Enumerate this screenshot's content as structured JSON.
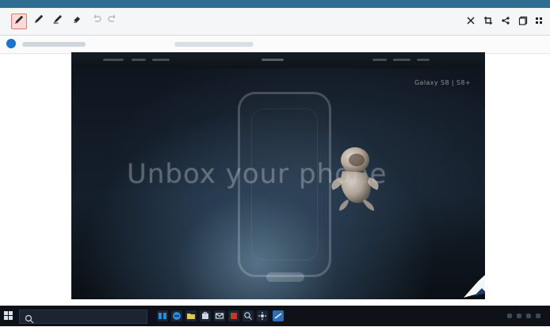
{
  "window": {
    "title": ""
  },
  "toolbar": {
    "left_tools": [
      {
        "name": "pen-tool-active-icon"
      },
      {
        "name": "pen-tool-icon"
      },
      {
        "name": "highlighter-icon"
      },
      {
        "name": "eraser-icon"
      },
      {
        "name": "undo-icon"
      },
      {
        "name": "redo-icon"
      }
    ],
    "right_tools": [
      {
        "name": "close-icon"
      },
      {
        "name": "crop-icon"
      },
      {
        "name": "share-icon"
      },
      {
        "name": "copy-icon"
      },
      {
        "name": "more-icon"
      }
    ]
  },
  "webpage": {
    "hero_text": "Unbox your phone",
    "top_right_label": "Galaxy S8 | S8+",
    "cta": ""
  },
  "taskbar": {
    "search_placeholder": "",
    "tray_time": ""
  },
  "colors": {
    "titlebar": "#2f6d91",
    "toolbar": "#f5f6f7",
    "taskbar": "#0e1218",
    "accent_active": "#e07a70"
  }
}
